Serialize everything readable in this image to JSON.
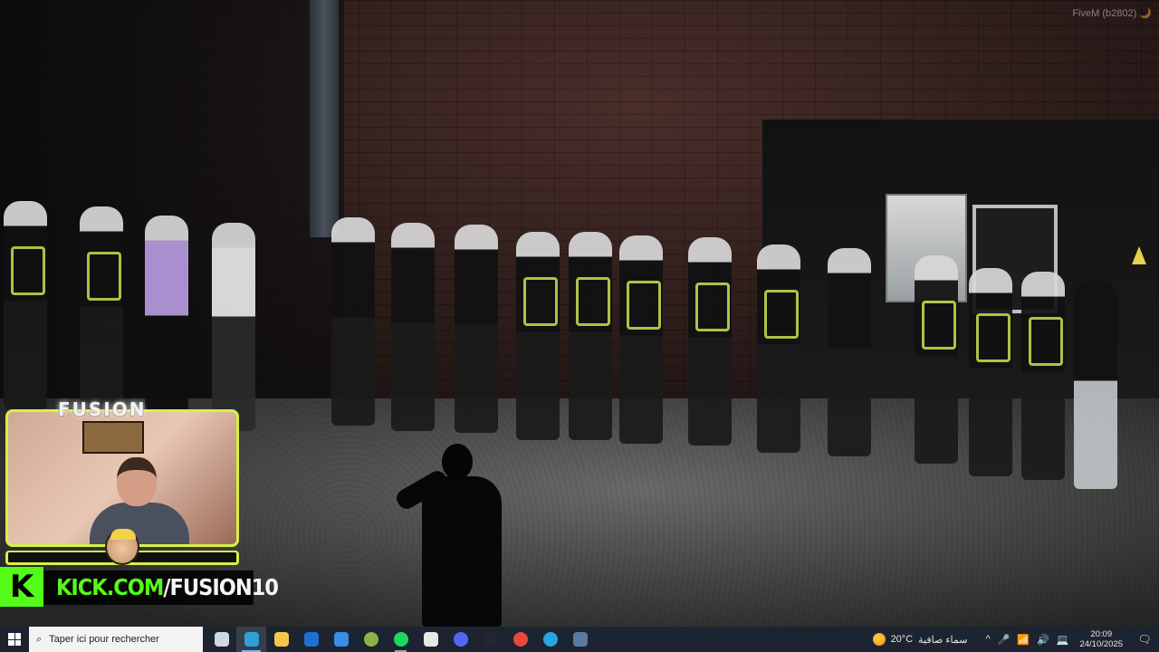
{
  "overlay": {
    "game_build": "FiveM (b2802) 🌙",
    "streamer_logo": "FUSION",
    "kick_domain": "KICK.COM",
    "kick_channel": "/FUSION10",
    "kick_badge": "K",
    "accent_color": "#d8f046",
    "kick_green": "#53fc18"
  },
  "taskbar": {
    "search_placeholder": "Taper ici pour rechercher",
    "apps": [
      {
        "name": "task-view",
        "color": "#cfd8e0"
      },
      {
        "name": "edge",
        "color": "#2ea0d8",
        "active": true
      },
      {
        "name": "file-explorer",
        "color": "#f2c84a"
      },
      {
        "name": "outlook",
        "color": "#1f6fd0"
      },
      {
        "name": "microsoft-store",
        "color": "#3a8ee8"
      },
      {
        "name": "xbox",
        "color": "#8ab44a"
      },
      {
        "name": "spotify",
        "color": "#1ed760",
        "running": true
      },
      {
        "name": "kick",
        "color": "#e8e8e8"
      },
      {
        "name": "discord",
        "color": "#5865f2"
      },
      {
        "name": "obs",
        "color": "#222831"
      },
      {
        "name": "chrome",
        "color": "#e84a3a"
      },
      {
        "name": "telegram",
        "color": "#2aa3e0"
      },
      {
        "name": "calculator",
        "color": "#5a7aa0"
      }
    ],
    "weather": {
      "temp": "20°C",
      "desc": "سماء صافية"
    },
    "tray_icons": [
      "^",
      "🎤",
      "📶",
      "🔊",
      "💻"
    ],
    "time": "20:09",
    "date": "24/10/2025",
    "notification": "🗨"
  }
}
